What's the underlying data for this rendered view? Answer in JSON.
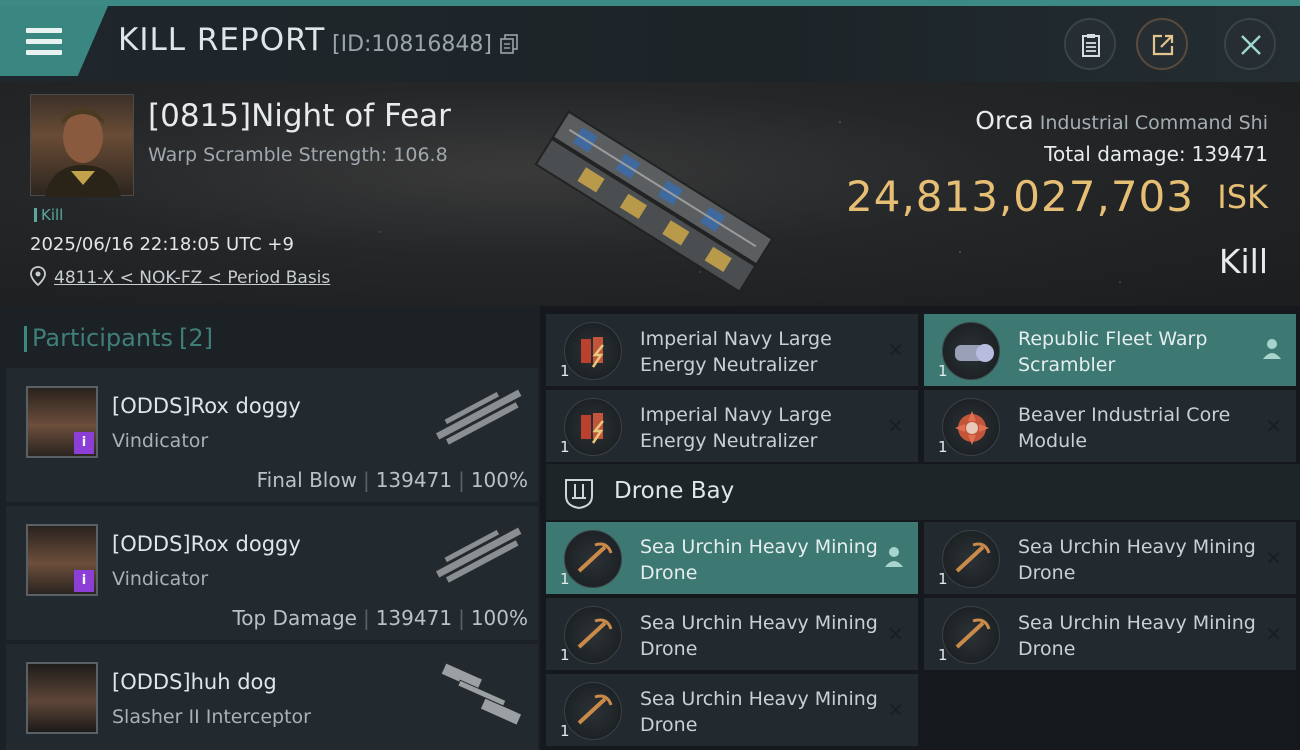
{
  "header": {
    "title": "KILL REPORT",
    "id_label": "[ID:10816848]"
  },
  "victim": {
    "name": "[0815]Night of Fear",
    "warp_scramble": "Warp Scramble Strength: 106.8",
    "kill_tag": "Kill",
    "timestamp": "2025/06/16 22:18:05 UTC +9",
    "location": "4811-X < NOK-FZ < Period Basis",
    "ship_name": "Orca",
    "ship_class": "Industrial Command Shi",
    "total_damage_label": "Total damage:",
    "total_damage": "139471",
    "isk_value": "24,813,027,703",
    "isk_unit": "ISK",
    "result": "Kill"
  },
  "participants": {
    "title": "Participants",
    "count": "[2]",
    "items": [
      {
        "name": "[ODDS]Rox doggy",
        "ship": "Vindicator",
        "role": "Final Blow",
        "damage": "139471",
        "percent": "100%",
        "badge": "i"
      },
      {
        "name": "[ODDS]Rox doggy",
        "ship": "Vindicator",
        "role": "Top Damage",
        "damage": "139471",
        "percent": "100%",
        "badge": "i"
      },
      {
        "name": "[ODDS]huh dog",
        "ship": "Slasher II Interceptor"
      }
    ]
  },
  "modules": [
    {
      "name": "Imperial Navy Large Energy Neutralizer",
      "qty": "1",
      "icon": "energy-neutralizer-icon"
    },
    {
      "name": "Republic Fleet Warp Scrambler",
      "qty": "1",
      "icon": "warp-scrambler-icon",
      "highlight": true
    },
    {
      "name": "Imperial Navy Large Energy Neutralizer",
      "qty": "1",
      "icon": "energy-neutralizer-icon"
    },
    {
      "name": "Beaver Industrial Core Module",
      "qty": "1",
      "icon": "industrial-core-icon"
    }
  ],
  "drone_bay": {
    "label": "Drone Bay",
    "items": [
      {
        "name": "Sea Urchin Heavy Mining Drone",
        "qty": "1",
        "highlight": true
      },
      {
        "name": "Sea Urchin Heavy Mining Drone",
        "qty": "1"
      },
      {
        "name": "Sea Urchin Heavy Mining Drone",
        "qty": "1"
      },
      {
        "name": "Sea Urchin Heavy Mining Drone",
        "qty": "1"
      },
      {
        "name": "Sea Urchin Heavy Mining Drone",
        "qty": "1"
      }
    ]
  },
  "symbols": {
    "close": "✕"
  },
  "colors": {
    "accent": "#3d8a84",
    "isk": "#e6be74",
    "badge": "#8b3fd6"
  }
}
